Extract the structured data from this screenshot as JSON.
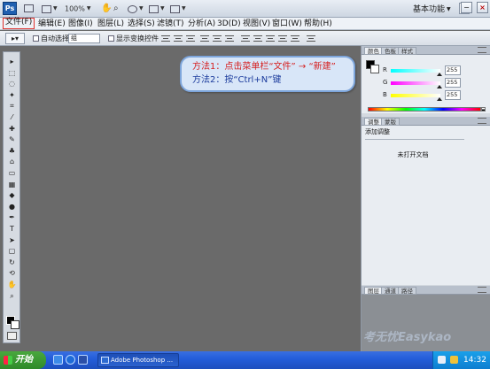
{
  "app": {
    "logo": "Ps",
    "zoom": "100%",
    "workspace_label": "基本功能",
    "window_controls": [
      "−",
      "□",
      "×"
    ]
  },
  "menu": {
    "items": [
      {
        "label": "文件(F)",
        "active": true
      },
      {
        "label": "编辑(E)"
      },
      {
        "label": "图像(I)"
      },
      {
        "label": "图层(L)"
      },
      {
        "label": "选择(S)"
      },
      {
        "label": "滤镜(T)"
      },
      {
        "label": "分析(A)"
      },
      {
        "label": "3D(D)"
      },
      {
        "label": "视图(V)"
      },
      {
        "label": "窗口(W)"
      },
      {
        "label": "帮助(H)"
      }
    ]
  },
  "options": {
    "auto_select_label": "自动选择:",
    "auto_select_value": "组",
    "show_transform_label": "显示变换控件"
  },
  "toolbox": {
    "tools": [
      "move-icon",
      "marquee-icon",
      "lasso-icon",
      "quick-select-icon",
      "crop-icon",
      "eyedropper-icon",
      "healing-icon",
      "brush-icon",
      "clone-stamp-icon",
      "history-brush-icon",
      "eraser-icon",
      "gradient-icon",
      "blur-icon",
      "dodge-icon",
      "pen-icon",
      "type-icon",
      "path-select-icon",
      "shape-icon",
      "3d-rotate-icon",
      "3d-orbit-icon",
      "hand-icon",
      "zoom-icon"
    ],
    "tool_glyphs": [
      "▸",
      "⬚",
      "◌",
      "✦",
      "⌗",
      "⁄",
      "✚",
      "✎",
      "♣",
      "⌂",
      "▭",
      "▦",
      "◆",
      "●",
      "✒",
      "T",
      "➤",
      "▢",
      "↻",
      "⟲",
      "✋",
      "⌕"
    ]
  },
  "callout": {
    "line1": "方法1：点击菜单栏“文件” → “新建”",
    "line2": "方法2：按“Ctrl+N”键"
  },
  "color_panel": {
    "tabs": [
      "颜色",
      "色板",
      "样式"
    ],
    "channels": [
      {
        "name": "R",
        "value": "255",
        "gradient": "linear-gradient(90deg,#00ffff,#ffffff)"
      },
      {
        "name": "G",
        "value": "255",
        "gradient": "linear-gradient(90deg,#ff00ff,#ffffff)"
      },
      {
        "name": "B",
        "value": "255",
        "gradient": "linear-gradient(90deg,#ffff00,#ffffff)"
      }
    ]
  },
  "adjust_panel": {
    "tabs": [
      "调整",
      "蒙版"
    ],
    "title": "添加调整",
    "message": "未打开文档"
  },
  "layers_panel": {
    "tabs": [
      "图层",
      "通道",
      "路径"
    ]
  },
  "taskbar": {
    "start_label": "开始",
    "task_label": "Adobe Photoshop ...",
    "clock": "14:32"
  },
  "watermark": "考无忧Easykao",
  "colors": {
    "accent_red": "#e0322e",
    "callout_bg": "#d8e6f8",
    "canvas_bg": "#6a6a6a"
  }
}
